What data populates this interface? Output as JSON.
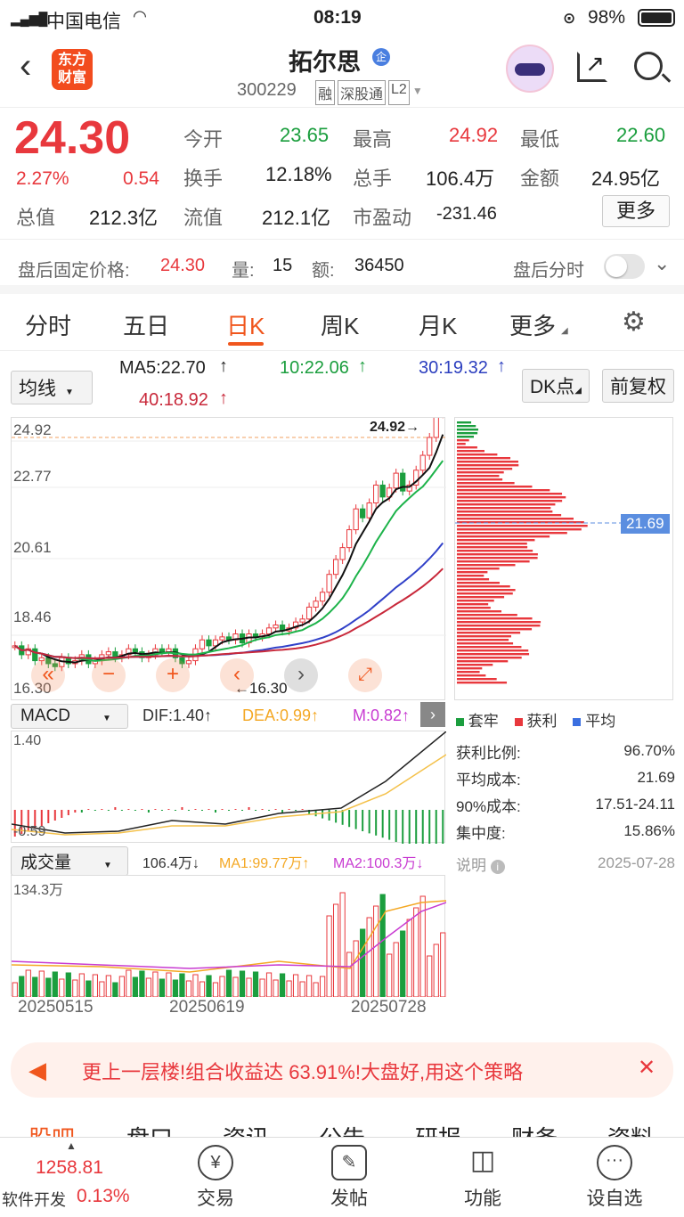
{
  "status": {
    "carrier": "中国电信",
    "time": "08:19",
    "battery": "98%"
  },
  "header": {
    "brand": "东方财富",
    "name": "拓尔思",
    "badge": "企",
    "code": "300229",
    "tags": [
      "融",
      "深股通",
      "L2"
    ]
  },
  "quote": {
    "price": "24.30",
    "pct": "2.27%",
    "chg": "0.54",
    "row1": [
      [
        "今开",
        "23.65"
      ],
      [
        "最高",
        "24.92"
      ],
      [
        "最低",
        "22.60"
      ]
    ],
    "row2": [
      [
        "换手",
        "12.18%"
      ],
      [
        "总手",
        "106.4万"
      ],
      [
        "金额",
        "24.95亿"
      ]
    ],
    "row3": [
      [
        "总值",
        "212.3亿"
      ],
      [
        "流值",
        "212.1亿"
      ],
      [
        "市盈动",
        "-231.46"
      ]
    ],
    "more": "更多"
  },
  "afterhours": {
    "label": "盘后固定价格:",
    "price": "24.30",
    "vol_label": "量:",
    "vol": "15",
    "amt_label": "额:",
    "amt": "36450",
    "toggle_label": "盘后分时"
  },
  "tabs": [
    "分时",
    "五日",
    "日K",
    "周K",
    "月K",
    "更多"
  ],
  "ma": {
    "select": "均线",
    "ma5": "MA5:22.70",
    "ma10": "10:22.06",
    "ma30": "30:19.32",
    "ma40": "40:18.92",
    "dk": "DK点",
    "fq": "前复权"
  },
  "kline": {
    "y_labels": [
      "24.92",
      "22.77",
      "20.61",
      "18.46",
      "16.30"
    ],
    "high_mark": "24.92",
    "low_mark": "16.30",
    "cost_mark": "21.69"
  },
  "macd": {
    "select": "MACD",
    "dif": "DIF:1.40",
    "dea": "DEA:0.99",
    "m": "M:0.82",
    "top": "1.40",
    "bottom": "-0.59"
  },
  "vol": {
    "select": "成交量",
    "v": "106.4万",
    "ma1": "MA1:99.77万",
    "ma2": "MA2:100.3万",
    "top": "134.3万",
    "dates": [
      "20250515",
      "20250619",
      "20250728"
    ]
  },
  "chip": {
    "legend": [
      "套牢",
      "获利",
      "平均"
    ],
    "rows": [
      [
        "获利比例:",
        "96.70%"
      ],
      [
        "平均成本:",
        "21.69"
      ],
      [
        "90%成本:",
        "17.51-24.11"
      ],
      [
        "集中度:",
        "15.86%"
      ]
    ],
    "note": "说明",
    "date": "2025-07-28"
  },
  "banner": {
    "text": "更上一层楼!组合收益达 63.91%!大盘好,用这个策略"
  },
  "subtabs": [
    "股吧",
    "盘口",
    "资讯",
    "公告",
    "研报",
    "财务",
    "资料"
  ],
  "bottom": {
    "index": "1258.81",
    "sector": "软件开发",
    "sector_pct": "0.13%",
    "items": [
      "交易",
      "发帖",
      "功能",
      "设自选"
    ]
  }
}
